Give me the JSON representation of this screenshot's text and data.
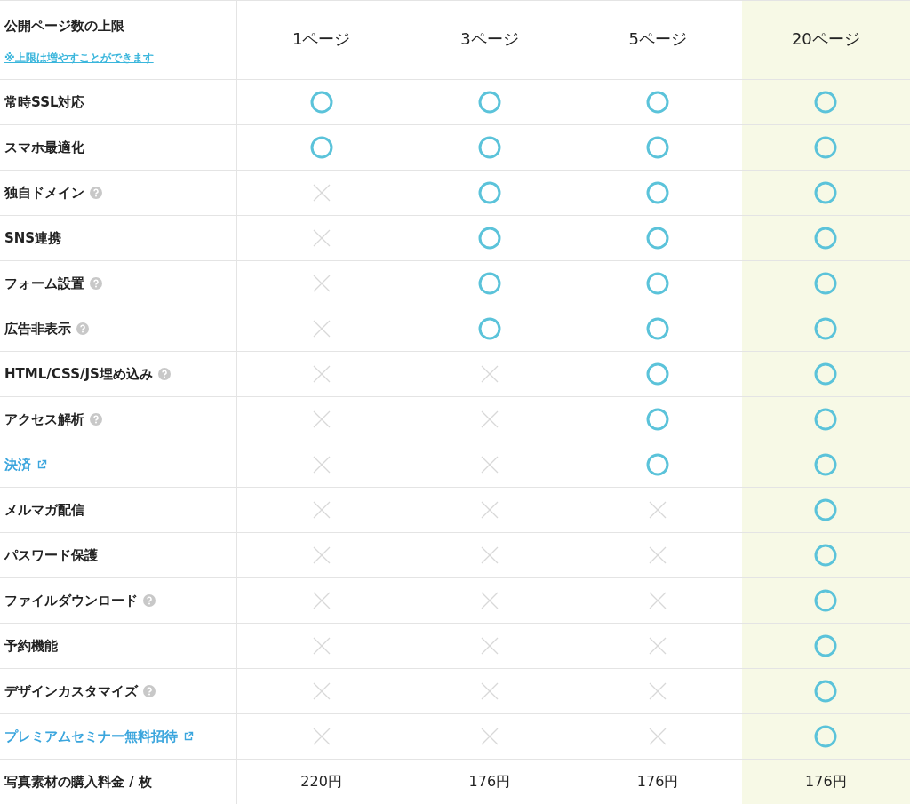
{
  "header": {
    "title": "公開ページ数の上限",
    "note": "※上限は増やすことができます",
    "plans": [
      {
        "label": "1ページ",
        "highlighted": false
      },
      {
        "label": "3ページ",
        "highlighted": false
      },
      {
        "label": "5ページ",
        "highlighted": false
      },
      {
        "label": "20ページ",
        "highlighted": true
      }
    ]
  },
  "features": [
    {
      "label": "常時SSL対応",
      "kind": "text",
      "help": false,
      "external": false,
      "available": [
        true,
        true,
        true,
        true
      ]
    },
    {
      "label": "スマホ最適化",
      "kind": "text",
      "help": false,
      "external": false,
      "available": [
        true,
        true,
        true,
        true
      ]
    },
    {
      "label": "独自ドメイン",
      "kind": "text",
      "help": true,
      "external": false,
      "available": [
        false,
        true,
        true,
        true
      ]
    },
    {
      "label": "SNS連携",
      "kind": "text",
      "help": false,
      "external": false,
      "available": [
        false,
        true,
        true,
        true
      ]
    },
    {
      "label": "フォーム設置",
      "kind": "text",
      "help": true,
      "external": false,
      "available": [
        false,
        true,
        true,
        true
      ]
    },
    {
      "label": "広告非表示",
      "kind": "text",
      "help": true,
      "external": false,
      "available": [
        false,
        true,
        true,
        true
      ]
    },
    {
      "label": "HTML/CSS/JS埋め込み",
      "kind": "text",
      "help": true,
      "external": false,
      "available": [
        false,
        false,
        true,
        true
      ]
    },
    {
      "label": "アクセス解析",
      "kind": "text",
      "help": true,
      "external": false,
      "available": [
        false,
        false,
        true,
        true
      ]
    },
    {
      "label": "決済",
      "kind": "link",
      "help": false,
      "external": true,
      "available": [
        false,
        false,
        true,
        true
      ]
    },
    {
      "label": "メルマガ配信",
      "kind": "text",
      "help": false,
      "external": false,
      "available": [
        false,
        false,
        false,
        true
      ]
    },
    {
      "label": "パスワード保護",
      "kind": "text",
      "help": false,
      "external": false,
      "available": [
        false,
        false,
        false,
        true
      ]
    },
    {
      "label": "ファイルダウンロード",
      "kind": "text",
      "help": true,
      "external": false,
      "available": [
        false,
        false,
        false,
        true
      ]
    },
    {
      "label": "予約機能",
      "kind": "text",
      "help": false,
      "external": false,
      "available": [
        false,
        false,
        false,
        true
      ]
    },
    {
      "label": "デザインカスタマイズ",
      "kind": "text",
      "help": true,
      "external": false,
      "available": [
        false,
        false,
        false,
        true
      ]
    },
    {
      "label": "プレミアムセミナー無料招待",
      "kind": "link",
      "help": false,
      "external": true,
      "available": [
        false,
        false,
        false,
        true
      ]
    }
  ],
  "price": {
    "label": "写真素材の購入料金 / 枚",
    "values": [
      "220円",
      "176円",
      "176円",
      "176円"
    ]
  }
}
